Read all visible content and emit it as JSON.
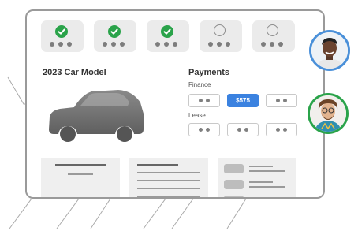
{
  "colors": {
    "accent_blue": "#3b82e0",
    "check_green": "#2aa34a",
    "avatar_ring_blue": "#4a90d9",
    "avatar_ring_green": "#2aa34a"
  },
  "steps": [
    {
      "state": "completed",
      "icon": "check-circle-icon"
    },
    {
      "state": "completed",
      "icon": "check-circle-icon"
    },
    {
      "state": "completed",
      "icon": "check-circle-icon"
    },
    {
      "state": "pending",
      "icon": "empty-circle-icon"
    },
    {
      "state": "pending",
      "icon": "empty-circle-icon"
    }
  ],
  "vehicle": {
    "title": "2023 Car Model",
    "image_icon": "suv-silhouette-icon"
  },
  "payments": {
    "title": "Payments",
    "finance_label": "Finance",
    "finance_selected_value": "$575",
    "lease_label": "Lease"
  },
  "avatars": [
    {
      "name": "avatar-person-1",
      "ring": "blue"
    },
    {
      "name": "avatar-person-2",
      "ring": "green"
    }
  ]
}
